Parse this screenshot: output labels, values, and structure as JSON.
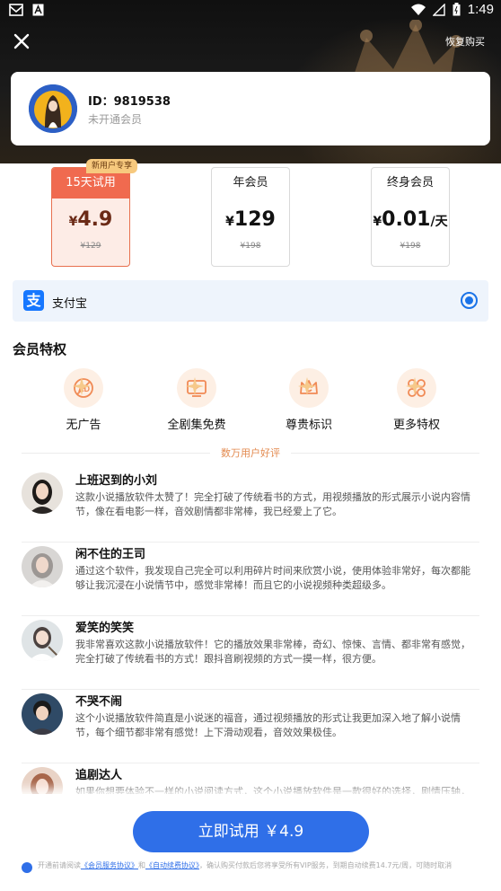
{
  "status_bar": {
    "time": "1:49"
  },
  "header": {
    "restore_label": "恢复购买"
  },
  "user": {
    "id_label": "ID：9819538",
    "vip_status": "未开通会员"
  },
  "plans": [
    {
      "name": "15天试用",
      "currency": "¥",
      "price": "4.9",
      "unit": "",
      "original": "¥129",
      "badge": "新用户专享",
      "selected": true
    },
    {
      "name": "年会员",
      "currency": "¥",
      "price": "129",
      "unit": "",
      "original": "¥198",
      "selected": false
    },
    {
      "name": "终身会员",
      "currency": "¥",
      "price": "0.01",
      "unit": "/天",
      "original": "¥198",
      "selected": false
    }
  ],
  "payment": {
    "method_label": "支付宝",
    "icon": "alipay-icon"
  },
  "perks": {
    "title": "会员特权",
    "items": [
      {
        "label": "无广告",
        "icon": "no-ads-icon"
      },
      {
        "label": "全剧集免费",
        "icon": "video-icon"
      },
      {
        "label": "尊贵标识",
        "icon": "crown-icon"
      },
      {
        "label": "更多特权",
        "icon": "more-icon"
      }
    ]
  },
  "reviews": {
    "title": "数万用户好评",
    "items": [
      {
        "name": "上班迟到的小刘",
        "text": "这款小说播放软件太赞了！完全打破了传统看书的方式，用视频播放的形式展示小说内容情节，像在看电影一样，音效剧情都非常棒，我已经爱上了它。"
      },
      {
        "name": "闲不住的王司",
        "text": "通过这个软件，我发现自己完全可以利用碎片时间来欣赏小说，使用体验非常好，每次都能够让我沉浸在小说情节中，感觉非常棒！而且它的小说视频种类超级多。"
      },
      {
        "name": "爱笑的笑笑",
        "text": "我非常喜欢这款小说播放软件！它的播放效果非常棒，奇幻、惊悚、言情、都非常有感觉，完全打破了传统看书的方式！跟抖音刷视频的方式一摸一样，很方便。"
      },
      {
        "name": "不哭不闹",
        "text": "这个小说播放软件简直是小说迷的福音，通过视频播放的形式让我更加深入地了解小说情节，每个细节都非常有感觉！上下滑动观看，音效效果极佳。"
      },
      {
        "name": "追剧达人",
        "text": "如果你想要体验不一样的小说阅读方式，这个小说播放软件是一款很好的选择，剧情压轴，"
      }
    ]
  },
  "cta": {
    "label": "立即试用 ￥4.9"
  },
  "agreement": {
    "prefix": "开通前请阅读",
    "link1": "《会员服务协议》",
    "and": "和",
    "link2": "《自动续费协议》",
    "suffix": "，确认购买付款后您将享受所有VIP服务，到期自动续费14.7元/周，可随时取消"
  },
  "colors": {
    "accent": "#2f6fe8",
    "plan_active": "#f06a4f",
    "badge": "#f7c97e"
  }
}
